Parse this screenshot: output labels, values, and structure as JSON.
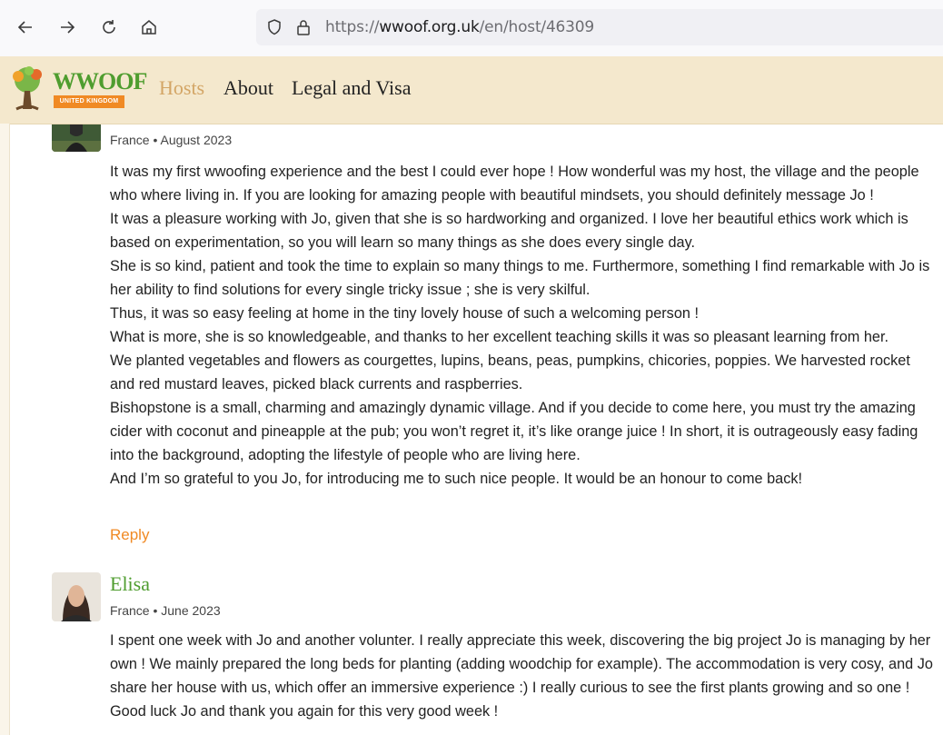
{
  "browser": {
    "url_prefix": "https://",
    "url_domain": "wwoof.org.uk",
    "url_path": "/en/host/46309"
  },
  "site": {
    "logo_text": "WWOOF",
    "logo_subtext": "UNITED KINGDOM",
    "nav": [
      "Hosts",
      "About",
      "Legal and Visa"
    ],
    "active_nav": "Hosts"
  },
  "reviews": [
    {
      "meta": "France • August 2023",
      "paragraphs": [
        "It was my first wwoofing experience and the best I could ever hope ! How wonderful was my host, the village and the people who where living in. If you are looking for amazing people with beautiful mindsets, you should definitely message Jo !",
        "It was a pleasure working with Jo, given that she is so hardworking and organized. I love her beautiful ethics work which is based on experimentation, so you will learn so many things as she does every single day.",
        "She is so kind, patient and took the time to explain so many things to me. Furthermore, something I find remarkable with Jo is her ability to find solutions for every single tricky issue ; she is very skilful.",
        "Thus, it was so easy feeling at home in the tiny lovely house of such a welcoming person !",
        "What is more, she is so knowledgeable, and thanks to her excellent teaching skills it was so pleasant learning from her.",
        "We planted vegetables and flowers as courgettes, lupins, beans, peas, pumpkins, chicories, poppies. We harvested rocket and red mustard leaves, picked black currents and raspberries.",
        "Bishopstone is a small, charming and amazingly dynamic village. And if you decide to come here, you must try the amazing cider with coconut and pineapple at the pub; you won’t regret it, it’s like orange juice ! In short, it is outrageously easy fading into the background, adopting the lifestyle of people who are living here.",
        "And I’m so grateful to you Jo, for introducing me to such nice people. It would be an honour to come back!"
      ],
      "reply_label": "Reply"
    },
    {
      "name": "Elisa",
      "meta": "France • June 2023",
      "paragraphs": [
        "I spent one week with Jo and another volunter. I really appreciate this week, discovering the big project Jo is managing by her own ! We mainly prepared the long beds for planting (adding woodchip for example). The accommodation is very cosy, and Jo share her house with us, which offer an immersive experience :) I really curious to see the first plants growing and so one ! Good luck Jo and thank you again for this very good week !"
      ]
    }
  ]
}
